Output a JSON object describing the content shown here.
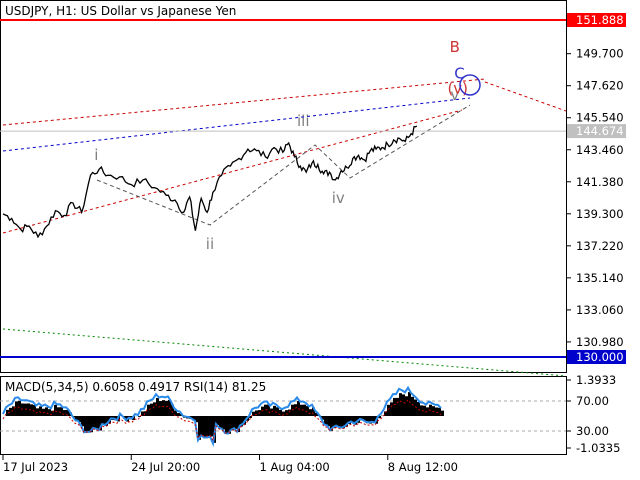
{
  "chart_data": {
    "type": "line",
    "symbol": "USDJPY",
    "timeframe": "H1",
    "description": "US Dollar vs Japanese Yen",
    "price_axis": {
      "ticks": [
        149.7,
        147.62,
        145.54,
        143.46,
        141.38,
        139.3,
        137.22,
        135.14,
        133.06,
        130.98
      ],
      "ylim": [
        130.0,
        152.4
      ]
    },
    "levels": [
      {
        "name": "resistance",
        "price": 151.888,
        "label": "151.888",
        "color": "#ff0000"
      },
      {
        "name": "support",
        "price": 130.0,
        "label": "130.000",
        "color": "#0000cc"
      }
    ],
    "current_price": {
      "price": 144.674,
      "label": "144.674"
    },
    "price_series": [
      [
        0,
        139.3
      ],
      [
        1.5,
        139.0
      ],
      [
        3,
        138.3
      ],
      [
        4.5,
        138.5
      ],
      [
        6,
        137.8
      ],
      [
        7.5,
        138.5
      ],
      [
        9,
        139.5
      ],
      [
        10.5,
        139.2
      ],
      [
        12,
        140.0
      ],
      [
        13.5,
        139.4
      ],
      [
        15,
        141.8
      ],
      [
        16.5,
        142.2
      ],
      [
        18,
        141.8
      ],
      [
        20,
        141.7
      ],
      [
        22,
        141.2
      ],
      [
        24,
        141.5
      ],
      [
        26,
        141.0
      ],
      [
        28,
        140.5
      ],
      [
        29.5,
        140.2
      ],
      [
        31,
        139.4
      ],
      [
        32,
        140.4
      ],
      [
        33,
        138.2
      ],
      [
        34,
        140.3
      ],
      [
        35,
        139.4
      ],
      [
        36,
        140.7
      ],
      [
        37.5,
        141.8
      ],
      [
        39,
        142.4
      ],
      [
        40.5,
        142.9
      ],
      [
        42,
        143.5
      ],
      [
        43.5,
        143.4
      ],
      [
        45,
        143.0
      ],
      [
        46.5,
        143.6
      ],
      [
        48,
        143.3
      ],
      [
        49,
        143.9
      ],
      [
        50,
        143.0
      ],
      [
        51,
        142.4
      ],
      [
        52,
        142.0
      ],
      [
        53,
        142.6
      ],
      [
        54,
        142.5
      ],
      [
        55,
        141.9
      ],
      [
        56,
        142.0
      ],
      [
        57,
        141.5
      ],
      [
        58,
        142.1
      ],
      [
        59,
        142.3
      ],
      [
        60,
        142.9
      ],
      [
        61,
        143.1
      ],
      [
        62,
        142.8
      ],
      [
        63,
        143.4
      ],
      [
        64,
        143.5
      ],
      [
        65,
        143.6
      ],
      [
        66,
        143.8
      ],
      [
        67,
        144.1
      ],
      [
        68,
        144.2
      ],
      [
        69,
        144.0
      ],
      [
        70,
        144.5
      ],
      [
        71,
        145.0
      ]
    ],
    "wave_labels": [
      {
        "text": "i",
        "x": 16,
        "price": 142.8,
        "color": "#808080"
      },
      {
        "text": "ii",
        "x": 35.5,
        "price": 137.0,
        "color": "#808080"
      },
      {
        "text": "iii",
        "x": 51.5,
        "price": 145.0,
        "color": "#808080"
      },
      {
        "text": "iv",
        "x": 57.5,
        "price": 140.0,
        "color": "#808080"
      },
      {
        "text": "v",
        "x": 77.5,
        "price": 146.7,
        "color": "#808080"
      },
      {
        "text": "(v)",
        "x": 78,
        "price": 147.1,
        "color": "#cc3333"
      },
      {
        "text": "C",
        "x": 78.3,
        "price": 148.1,
        "color": "#3333cc"
      },
      {
        "text": "B",
        "x": 77.5,
        "price": 149.8,
        "color": "#cc3333"
      }
    ],
    "x_axis": {
      "ticks": [
        {
          "x": 0,
          "label": "17 Jul 2023"
        },
        {
          "x": 22,
          "label": "24 Jul 20:00"
        },
        {
          "x": 44,
          "label": "1 Aug 04:00"
        },
        {
          "x": 66,
          "label": "8 Aug 12:00"
        }
      ]
    },
    "indicator": {
      "title": "MACD(5,34,5) 0.6058 0.4917 RSI(14) 81.25",
      "axis_labels": [
        "1.3933",
        "70.00",
        "30.00",
        "-1.0335"
      ]
    }
  },
  "header": {
    "title": "USDJPY, H1:  US Dollar vs Japanese Yen"
  }
}
